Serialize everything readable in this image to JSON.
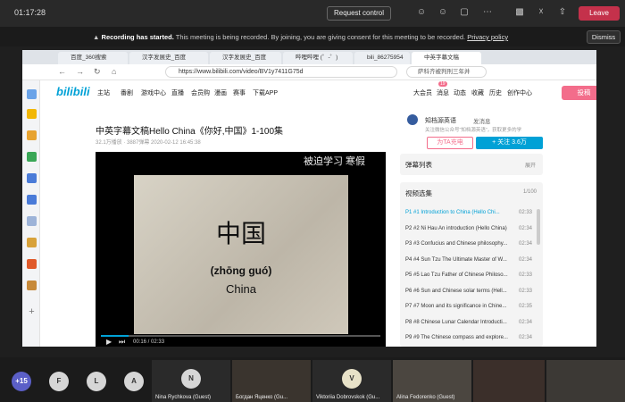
{
  "teams": {
    "timer": "01:17:28",
    "request_control": "Request control",
    "leave": "Leave",
    "recording_bold": "Recording has started.",
    "recording_text": "This meeting is being recorded. By joining, you are giving consent for this meeting to be recorded.",
    "privacy_link": "Privacy policy",
    "dismiss": "Dismiss"
  },
  "browser": {
    "tabs": [
      "百度_360搜索",
      "汉字发展史_百度",
      "汉字发展史_百度",
      "哔哩哔哩 (゜-゜)",
      "bili_86275954",
      "中英字幕文稿"
    ],
    "address": "https://www.bilibili.com/video/BV1y7411G75d",
    "search": "萨科齐被判刑三年并"
  },
  "bili": {
    "logo": "bilibili",
    "nav": [
      "主站",
      "番剧",
      "游戏中心",
      "直播",
      "会员购",
      "漫画",
      "赛事",
      "下载APP"
    ],
    "right_nav": [
      "大会员",
      "消息",
      "动态",
      "收藏",
      "历史",
      "创作中心"
    ],
    "msg_badge": "19",
    "upload": "投稿"
  },
  "video": {
    "title": "中英字幕文稿Hello China《你好,中国》1-100集",
    "meta": "32.1万播放 · 3887弹幕   2020-02-12 16:45:38",
    "danmu_overlay": "被迫学习    寒假",
    "frame_hanzi": "中国",
    "frame_pinyin": "(zhōng guó)",
    "frame_english": "China",
    "time": "00:16 / 02:33",
    "progress": 0.1
  },
  "uploader": {
    "name": "知档源英语",
    "msg": "发消息",
    "desc": "关注微信公众号“知档源英语”，获取更多的学",
    "charge": "为TA充电",
    "follow": "+ 关注 3.6万"
  },
  "panel": {
    "danmu_list": "弹幕列表",
    "expand": "展开",
    "ep_title": "视频选集",
    "ep_count": "1/100",
    "episodes": [
      {
        "t": "P1 #1 Introduction to China (Hello Chi...",
        "d": "02:33"
      },
      {
        "t": "P2 #2 Ni Hau An introduction (Hello China)",
        "d": "02:34"
      },
      {
        "t": "P3 #3 Confucius and Chinese philosophy...",
        "d": "02:34"
      },
      {
        "t": "P4 #4 Sun Tzu The Ultimate Master of W...",
        "d": "02:34"
      },
      {
        "t": "P5 #5 Lao Tzu Father of Chinese Philoso...",
        "d": "02:33"
      },
      {
        "t": "P6 #6 Sun and Chinese solar terms (Hell...",
        "d": "02:33"
      },
      {
        "t": "P7 #7 Moon and its significance in Chine...",
        "d": "02:35"
      },
      {
        "t": "P8 #8 Chinese Lunar Calendar Introducti...",
        "d": "02:34"
      },
      {
        "t": "P9 #9 The Chinese compass and explore...",
        "d": "02:34"
      }
    ]
  },
  "participants": {
    "more": "+15",
    "initials": [
      "F",
      "L",
      "A"
    ],
    "tiles": [
      {
        "initial": "N",
        "name": "Nina Rychkova (Guest)"
      },
      {
        "initial": "",
        "name": "Богдан Яценко (Gu..."
      },
      {
        "initial": "V",
        "name": "Viktoriia Dobrovskok (Gu..."
      },
      {
        "initial": "",
        "name": "Alina Fedorenko (Guest)"
      },
      {
        "initial": "",
        "name": ""
      },
      {
        "initial": "",
        "name": ""
      }
    ]
  }
}
